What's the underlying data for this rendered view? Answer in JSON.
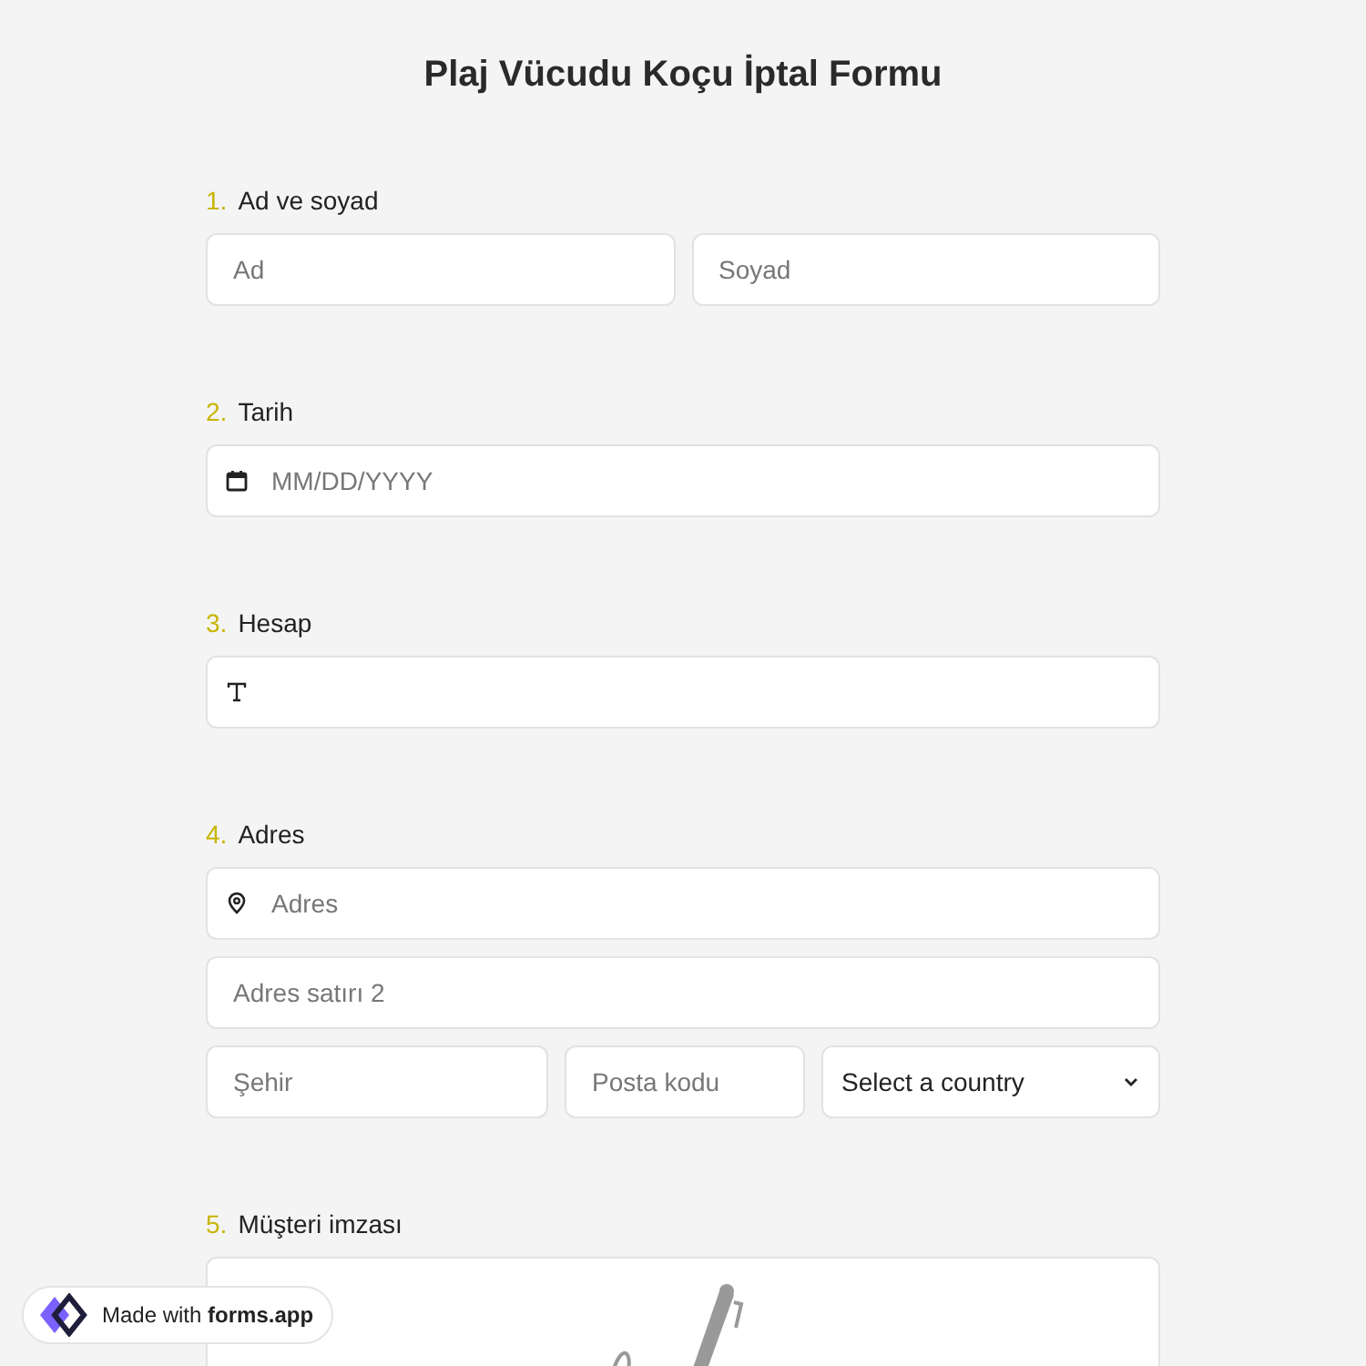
{
  "title": "Plaj Vücudu Koçu İptal Formu",
  "questions": [
    {
      "number": "1.",
      "label": "Ad ve soyad",
      "kind": "name",
      "fields": [
        {
          "placeholder": "Ad"
        },
        {
          "placeholder": "Soyad"
        }
      ]
    },
    {
      "number": "2.",
      "label": "Tarih",
      "kind": "date",
      "placeholder": "MM/DD/YYYY"
    },
    {
      "number": "3.",
      "label": "Hesap",
      "kind": "text"
    },
    {
      "number": "4.",
      "label": "Adres",
      "kind": "address",
      "address": {
        "placeholder": "Adres"
      },
      "line2": {
        "placeholder": "Adres satırı 2"
      },
      "city": {
        "placeholder": "Şehir"
      },
      "zip": {
        "placeholder": "Posta kodu"
      },
      "country": {
        "value": "Select a country"
      }
    },
    {
      "number": "5.",
      "label": "Müşteri imzası",
      "kind": "signature"
    }
  ],
  "badge": {
    "text": "Made with **forms.app**"
  }
}
